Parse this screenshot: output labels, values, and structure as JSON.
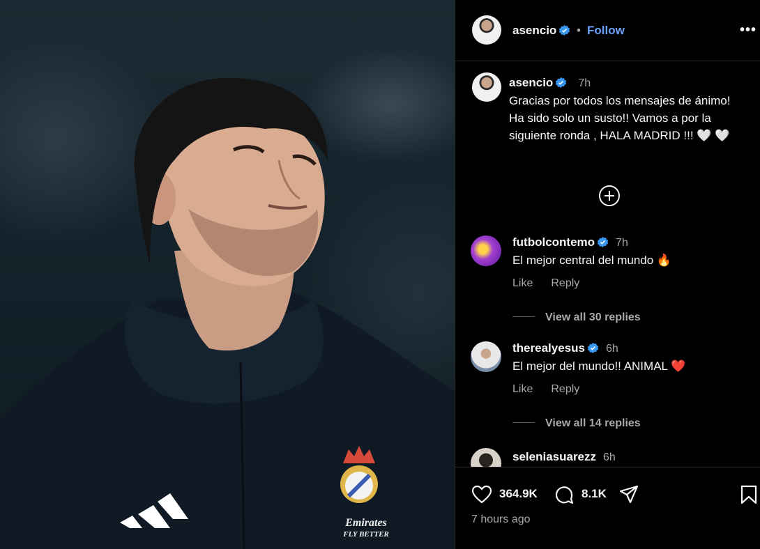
{
  "post": {
    "author": "asencio",
    "follow_label": "Follow",
    "more_label": "•••",
    "caption_time": "7h",
    "caption": "Gracias por todos los mensajes de ánimo! Ha sido solo un susto!! Vamos a por la siguiente ronda , HALA MADRID !!! 🤍 🤍",
    "likes": "364.9K",
    "comments_count": "8.1K",
    "posted_ago": "7 hours ago"
  },
  "comments": [
    {
      "user": "futbolcontemo",
      "verified": true,
      "time": "7h",
      "text": "El mejor central del mundo 🔥",
      "like_label": "Like",
      "reply_label": "Reply",
      "view_replies": "View all 30 replies"
    },
    {
      "user": "therealyesus",
      "verified": true,
      "time": "6h",
      "text": "El mejor del mundo!! ANIMAL ❤️",
      "like_label": "Like",
      "reply_label": "Reply",
      "view_replies": "View all 14 replies"
    },
    {
      "user": "seleniasuarezz",
      "verified": false,
      "time": "6h"
    }
  ],
  "photo": {
    "sponsor_text_line1": "Emirates",
    "sponsor_text_line2": "FLY BETTER"
  },
  "icons": {
    "verified": "verified-badge-icon",
    "add": "plus-circle-icon",
    "like": "heart-icon",
    "comment": "comment-bubble-icon",
    "share": "paper-plane-icon",
    "save": "bookmark-icon"
  },
  "colors": {
    "accent": "#6ba3ff",
    "verified": "#3897f0",
    "muted": "#a8a8a8",
    "background": "#000000"
  }
}
